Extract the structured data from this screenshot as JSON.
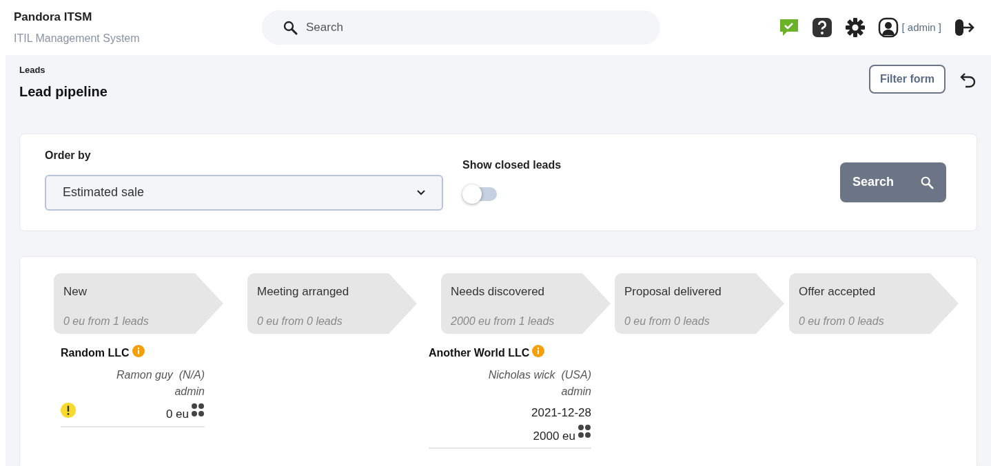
{
  "header": {
    "app_name": "Pandora ITSM",
    "subtitle": "ITIL Management System",
    "search": {
      "placeholder": "Search"
    },
    "user": "[ admin ]"
  },
  "breadcrumb": "Leads",
  "title": "Lead pipeline",
  "filter_button": "Filter form",
  "filters": {
    "order_by": {
      "label": "Order by",
      "value": "Estimated sale"
    },
    "show_closed": {
      "label": "Show closed leads",
      "on": false
    },
    "search_button": "Search"
  },
  "stages": [
    {
      "name": "New",
      "summary": "0 eu from 1 leads",
      "leads": [
        {
          "company": "Random LLC",
          "contact": "Ramon guy  (N/A)",
          "owner": "admin",
          "warning": true,
          "amount": "0 eu"
        }
      ]
    },
    {
      "name": "Meeting arranged",
      "summary": "0 eu from 0 leads"
    },
    {
      "name": "Needs discovered",
      "summary": "2000 eu from 1 leads",
      "leads": [
        {
          "company": "Another World LLC",
          "contact": "Nicholas wick  (USA)",
          "owner": "admin",
          "warning": false,
          "date": "2021-12-28",
          "amount": "2000 eu"
        }
      ]
    },
    {
      "name": "Proposal delivered",
      "summary": "0 eu from 0 leads"
    },
    {
      "name": "Offer accepted",
      "summary": "0 eu from 0 leads"
    }
  ]
}
